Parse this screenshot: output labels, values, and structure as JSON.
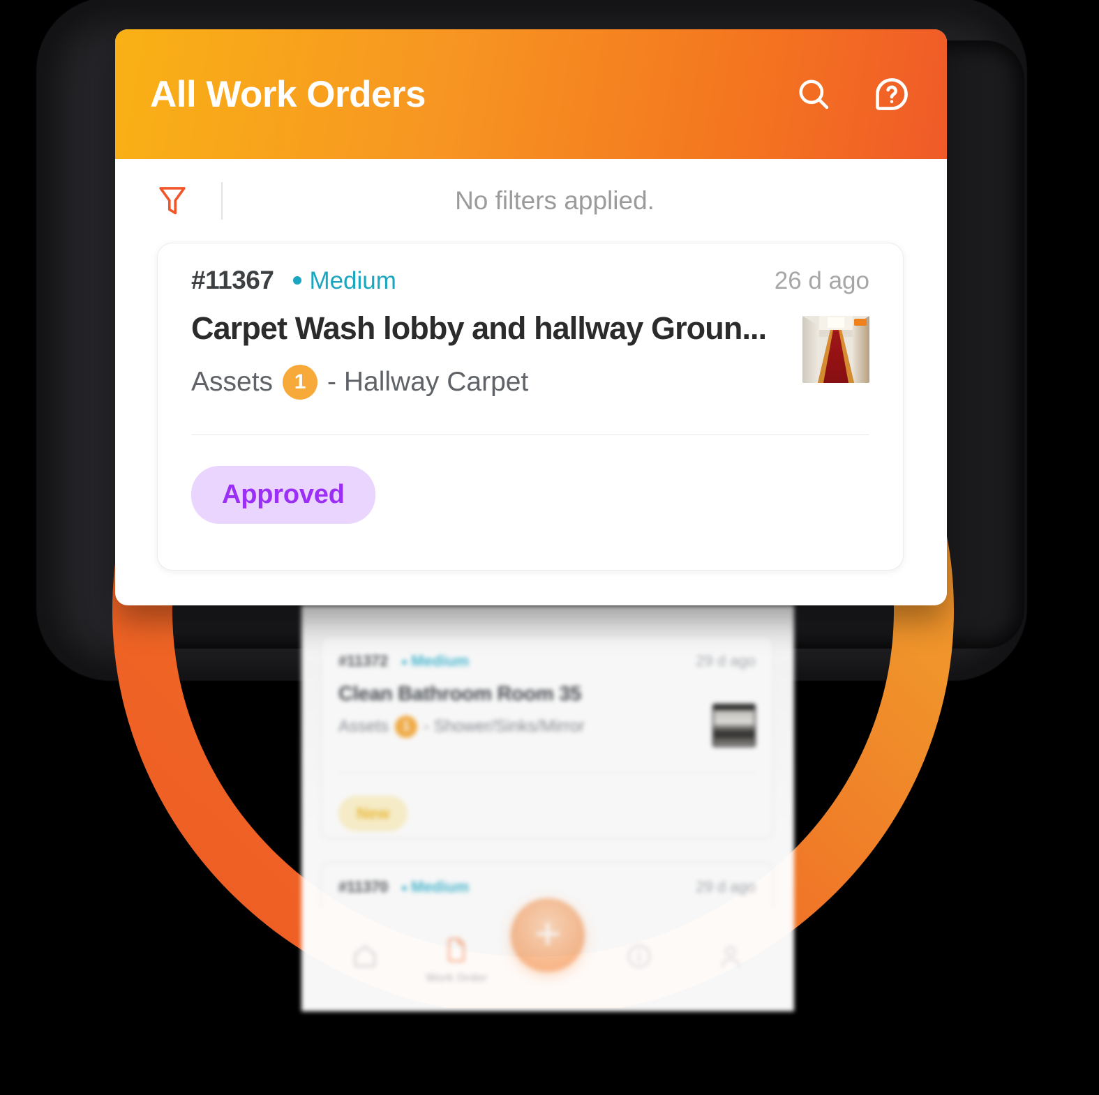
{
  "header": {
    "title": "All Work Orders",
    "search_icon": "search-icon",
    "help_icon": "help-circle-icon"
  },
  "filter_bar": {
    "icon": "filter-funnel-icon",
    "text": "No filters applied."
  },
  "work_order_card": {
    "id": "#11367",
    "priority": "Medium",
    "time_ago": "26 d ago",
    "title": "Carpet Wash lobby and hallway Groun...",
    "assets_label": "Assets",
    "assets_count": "1",
    "assets_name": "- Hallway Carpet",
    "status": "Approved",
    "thumbnail_alt": "hallway-carpet-photo"
  },
  "background_screen": {
    "cards": [
      {
        "id": "#11372",
        "priority": "Medium",
        "time_ago": "29 d ago",
        "title": "Clean Bathroom Room 35",
        "assets_label": "Assets",
        "assets_count": "1",
        "assets_name": "- Shower/Sinks/Mirror",
        "status": "New"
      },
      {
        "id": "#11370",
        "priority": "Medium",
        "time_ago": "29 d ago"
      }
    ],
    "bottom_nav": {
      "items": [
        {
          "icon": "home-icon",
          "label": ""
        },
        {
          "icon": "document-icon",
          "label": "Work Order"
        },
        {
          "icon": "plus-icon",
          "label": ""
        },
        {
          "icon": "info-circle-icon",
          "label": ""
        },
        {
          "icon": "person-icon",
          "label": ""
        }
      ]
    }
  },
  "colors": {
    "header_gradient_start": "#F9B115",
    "header_gradient_end": "#F05A28",
    "priority_teal": "#1AA6C0",
    "assets_badge_orange": "#F7AA3A",
    "status_approved_bg": "#E9D5FD",
    "status_approved_text": "#9C2FF5",
    "status_new_bg": "#FDF3CD",
    "status_new_text": "#F2C141",
    "ring_orange": "#F0942B",
    "ring_red_orange": "#EE5A24",
    "filter_icon_orange": "#F05A28"
  }
}
